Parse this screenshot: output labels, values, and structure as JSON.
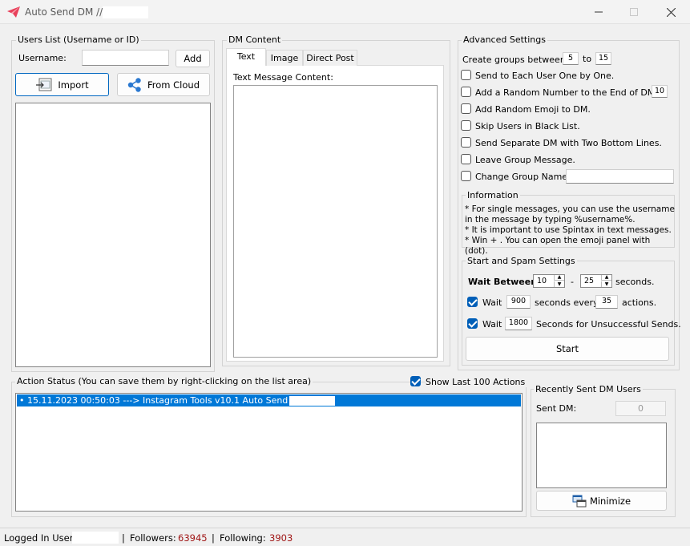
{
  "window": {
    "title": "Auto Send DM //"
  },
  "users_list": {
    "group_title": "Users List (Username or ID)",
    "username_label": "Username:",
    "username_value": "",
    "add_label": "Add",
    "import_label": "Import",
    "from_cloud_label": "From Cloud"
  },
  "dm_content": {
    "group_title": "DM Content",
    "tabs": [
      "Text",
      "Image",
      "Direct Post"
    ],
    "text_label": "Text Message Content:"
  },
  "advanced": {
    "group_title": "Advanced Settings",
    "groups_between_label": "Create groups between",
    "groups_min": "5",
    "to_label": "to",
    "groups_max": "15",
    "options": [
      {
        "label": "Send to Each User One by One.",
        "checked": false
      },
      {
        "label": "Add a Random Number to the End of DM:",
        "checked": false
      },
      {
        "label": "Add Random Emoji to DM.",
        "checked": false
      },
      {
        "label": "Skip Users in Black List.",
        "checked": false
      },
      {
        "label": "Send Separate DM  with Two Bottom Lines.",
        "checked": false
      },
      {
        "label": "Leave Group Message.",
        "checked": false
      },
      {
        "label": "Change Group Name:",
        "checked": false
      }
    ],
    "random_number_value": "10",
    "group_name_value": ""
  },
  "information": {
    "group_title": "Information",
    "lines": [
      "* For single messages, you can use the username",
      "in the message by typing %username%.",
      "* It is important to use Spintax in text messages.",
      "* Win + . You can open the emoji panel with (dot)."
    ]
  },
  "start_spam": {
    "group_title": "Start and Spam Settings",
    "wait_between_label": "Wait Between:",
    "wait_min": "10",
    "dash": "-",
    "wait_max": "25",
    "seconds_label": "seconds.",
    "wait1_label": "Wait",
    "wait1_value": "900",
    "seconds_every_label": "seconds every",
    "actions_value": "35",
    "actions_label": "actions.",
    "wait2_label": "Wait",
    "wait2_value": "1800",
    "unsuccessful_label": "Seconds for Unsuccessful Sends.",
    "start_label": "Start"
  },
  "action_status": {
    "group_title": "Action Status (You can save them by right-clicking on the list area)",
    "show_last_label": "Show Last 100 Actions",
    "entries": [
      "15.11.2023 00:50:03 ---> Instagram Tools v10.1 Auto Send DM //"
    ]
  },
  "recent": {
    "group_title": "Recently Sent DM Users",
    "sent_label": "Sent DM:",
    "sent_count": "0",
    "minimize_label": "Minimize"
  },
  "status": {
    "logged_label": "Logged In User:",
    "sep": "|",
    "followers_label": "Followers:",
    "followers_value": "63945",
    "following_label": "Following:",
    "following_value": "3903"
  },
  "colors": {
    "accent": "#005fb8",
    "selection": "#0078d7",
    "counter": "#a01616",
    "app_icon": "#e8405a"
  }
}
